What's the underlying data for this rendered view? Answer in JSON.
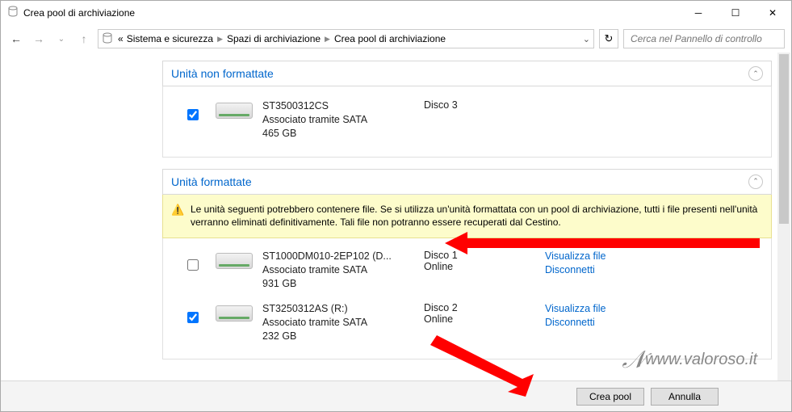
{
  "window": {
    "title": "Crea pool di archiviazione"
  },
  "breadcrumb": {
    "root": "«",
    "items": [
      "Sistema e sicurezza",
      "Spazi di archiviazione",
      "Crea pool di archiviazione"
    ]
  },
  "search": {
    "placeholder": "Cerca nel Pannello di controllo"
  },
  "sections": {
    "unformatted": {
      "title": "Unità non formattate",
      "drives": [
        {
          "checked": true,
          "model": "ST3500312CS",
          "conn": "Associato tramite SATA",
          "size": "465 GB",
          "diskno": "Disco 3",
          "status": ""
        }
      ]
    },
    "formatted": {
      "title": "Unità formattate",
      "warning": "Le unità seguenti potrebbero contenere file. Se si utilizza un'unità formattata con un pool di archiviazione, tutti i file presenti nell'unità verranno eliminati definitivamente. Tali file non potranno essere recuperati dal Cestino.",
      "drives": [
        {
          "checked": false,
          "model": "ST1000DM010-2EP102 (D...",
          "conn": "Associato tramite SATA",
          "size": "931 GB",
          "diskno": "Disco 1",
          "status": "Online"
        },
        {
          "checked": true,
          "model": "ST3250312AS (R:)",
          "conn": "Associato tramite SATA",
          "size": "232 GB",
          "diskno": "Disco 2",
          "status": "Online"
        }
      ],
      "actions": {
        "view": "Visualizza file",
        "disconnect": "Disconnetti"
      }
    }
  },
  "footer": {
    "create": "Crea pool",
    "cancel": "Annulla"
  },
  "watermark": "www.valoroso.it"
}
